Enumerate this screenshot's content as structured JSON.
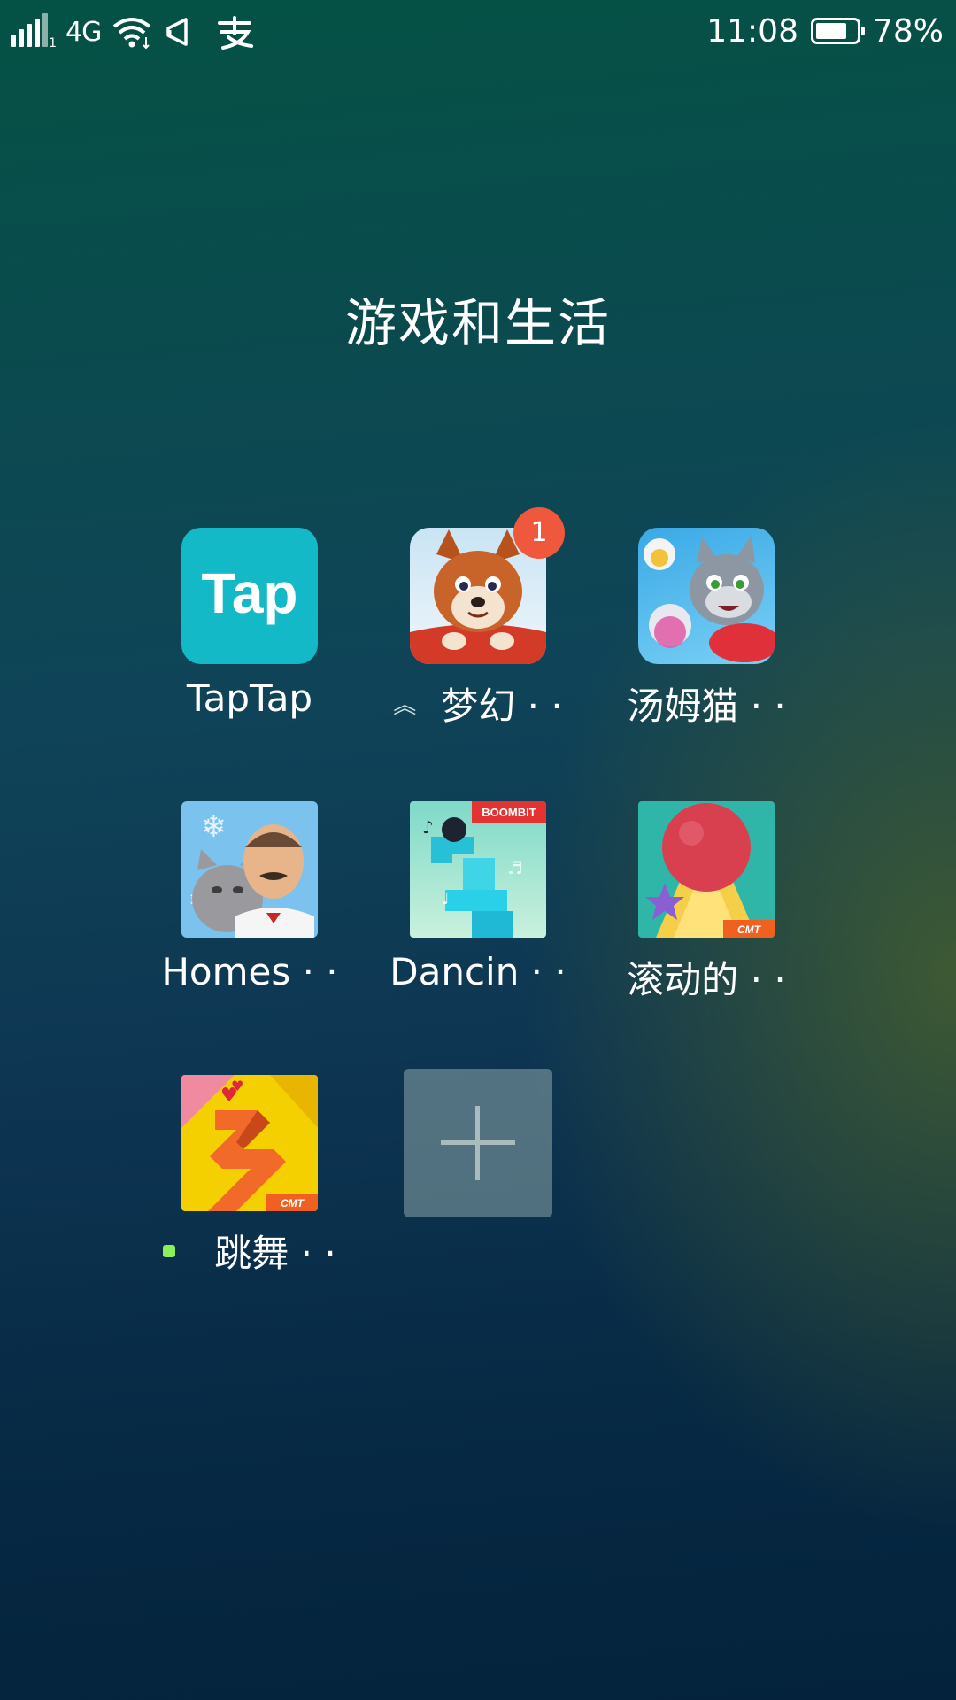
{
  "status_bar": {
    "sim_slot": "1",
    "network": "4G",
    "time": "11:08",
    "battery_percent": "78%",
    "battery_level": 0.78,
    "icons": [
      "signal-icon",
      "wifi-icon",
      "notification-sound-icon",
      "alipay-icon",
      "battery-icon"
    ]
  },
  "folder": {
    "title": "游戏和生活",
    "apps": [
      {
        "label": "TapTap",
        "icon": "taptap-icon",
        "logo_text": "Tap"
      },
      {
        "label": "梦幻 · ·",
        "icon": "dream-dog-game-icon",
        "badge": "1",
        "indicator": "update-arrow"
      },
      {
        "label": "汤姆猫 · ·",
        "icon": "talking-tom-icon"
      },
      {
        "label": "Homes · ·",
        "icon": "homescapes-icon"
      },
      {
        "label": "Dancin · ·",
        "icon": "dancing-ball-icon",
        "brand": "BOOMBIT"
      },
      {
        "label": "滚动的 · ·",
        "icon": "rolling-ball-icon",
        "brand": "CMT"
      },
      {
        "label": "跳舞 · ·",
        "icon": "dancing-line-icon",
        "brand": "CMT",
        "indicator": "new-dot"
      }
    ],
    "add_button": "add-icon"
  },
  "colors": {
    "badge": "#f0583e",
    "new_dot": "#8df05a",
    "taptap": "#14b9c8"
  }
}
